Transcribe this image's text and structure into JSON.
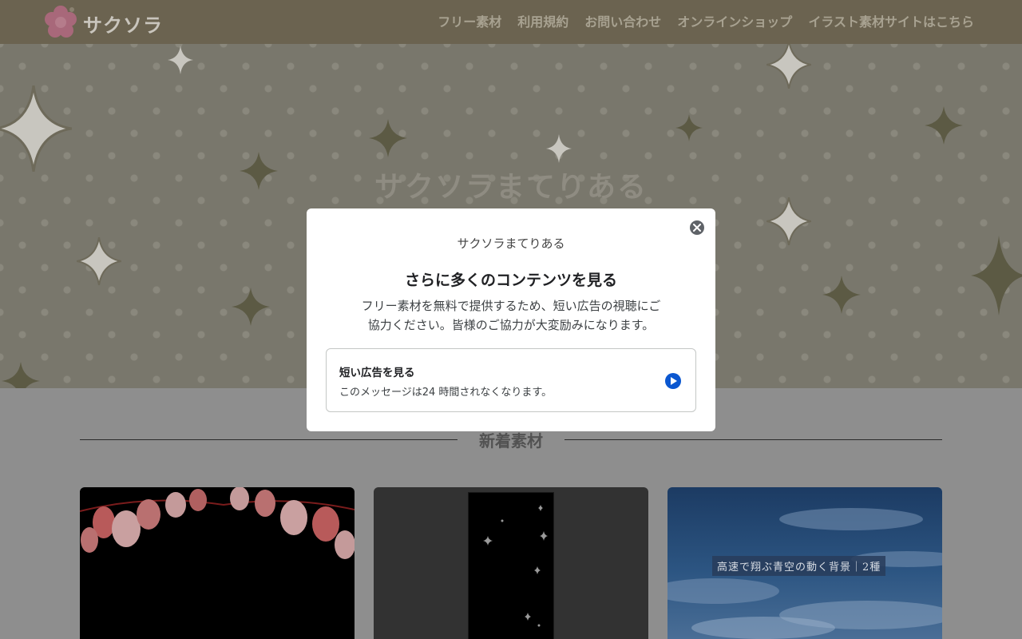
{
  "header": {
    "logo_text": "サクソラ",
    "nav": [
      {
        "label": "フリー素材"
      },
      {
        "label": "利用規約"
      },
      {
        "label": "お問い合わせ"
      },
      {
        "label": "オンラインショップ"
      },
      {
        "label": "イラスト素材サイトはこちら"
      }
    ]
  },
  "hero": {
    "title": "サクソラまてりある"
  },
  "section": {
    "title": "新着素材"
  },
  "cards": [
    {
      "icon": "lanterns-image"
    },
    {
      "icon": "sparkle-phone-image"
    },
    {
      "label": "高速で翔ぶ青空の動く背景｜2種"
    }
  ],
  "modal": {
    "site_name": "サクソラまてりある",
    "title": "さらに多くのコンテンツを見る",
    "description_line1": "フリー素材を無料で提供するため、短い広告の視聴にご",
    "description_line2": "協力ください。皆様のご協力が大変励みになります。",
    "option": {
      "label": "短い広告を見る",
      "sub": "このメッセージは24 時間されなくなります。"
    }
  },
  "colors": {
    "header_bg": "#6b6350",
    "overlay": "#8e8e8e",
    "modal_bg": "#ffffff",
    "play_blue": "#0b57d0"
  }
}
